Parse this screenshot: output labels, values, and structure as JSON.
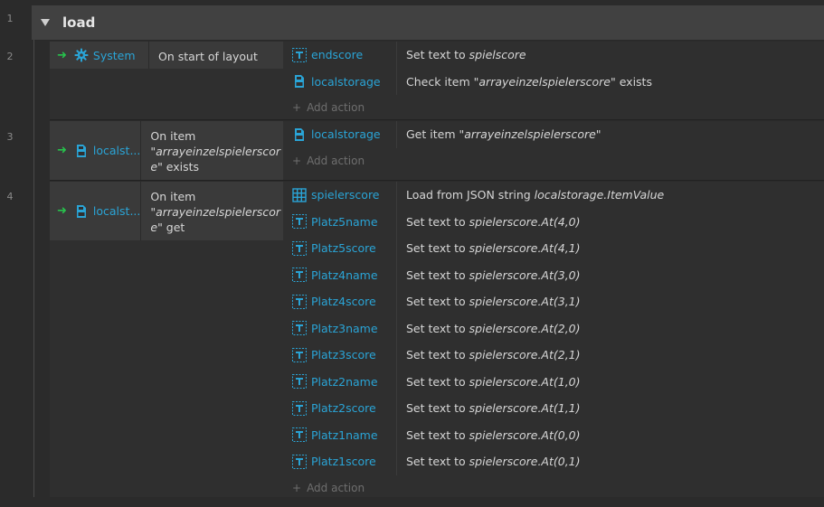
{
  "line_numbers": [
    "1",
    "2",
    "3",
    "4"
  ],
  "group": {
    "title": "load"
  },
  "add_action_label": "Add action",
  "events": [
    {
      "condition": {
        "object": "System",
        "icon": "gear-icon",
        "parts": [
          {
            "t": "On start of layout",
            "i": false
          }
        ]
      },
      "actions": [
        {
          "object": "endscore",
          "icon": "text-icon",
          "parts": [
            {
              "t": "Set text to ",
              "i": false
            },
            {
              "t": "spielscore",
              "i": true
            }
          ]
        },
        {
          "object": "localstorage",
          "icon": "local-storage-icon",
          "parts": [
            {
              "t": "Check item ",
              "i": false
            },
            {
              "t": "\"arrayeinzelspielerscore\"",
              "i": true
            },
            {
              "t": " exists",
              "i": false
            }
          ]
        }
      ]
    },
    {
      "condition": {
        "object": "localst...",
        "icon": "local-storage-icon",
        "parts": [
          {
            "t": "On item ",
            "i": false
          },
          {
            "t": "\"arrayeinzelspielerscor",
            "i": true
          },
          {
            "t": "e\"",
            "i": true
          },
          {
            "t": " exists",
            "i": false
          }
        ]
      },
      "actions": [
        {
          "object": "localstorage",
          "icon": "local-storage-icon",
          "parts": [
            {
              "t": "Get item ",
              "i": false
            },
            {
              "t": "\"arrayeinzelspielerscore\"",
              "i": true
            }
          ]
        }
      ]
    },
    {
      "condition": {
        "object": "localst...",
        "icon": "local-storage-icon",
        "parts": [
          {
            "t": "On item ",
            "i": false
          },
          {
            "t": "\"arrayeinzelspielerscor",
            "i": true
          },
          {
            "t": "e\"",
            "i": true
          },
          {
            "t": " get",
            "i": false
          }
        ]
      },
      "actions": [
        {
          "object": "spielerscore",
          "icon": "array-grid-icon",
          "parts": [
            {
              "t": "Load from JSON string ",
              "i": false
            },
            {
              "t": "localstorage.ItemValue",
              "i": true
            }
          ]
        },
        {
          "object": "Platz5name",
          "icon": "text-icon",
          "parts": [
            {
              "t": "Set text to ",
              "i": false
            },
            {
              "t": "spielerscore.At",
              "i": true
            },
            {
              "t": "(4,0)",
              "i": true
            }
          ]
        },
        {
          "object": "Platz5score",
          "icon": "text-icon",
          "parts": [
            {
              "t": "Set text to ",
              "i": false
            },
            {
              "t": "spielerscore.At",
              "i": true
            },
            {
              "t": "(4,1)",
              "i": true
            }
          ]
        },
        {
          "object": "Platz4name",
          "icon": "text-icon",
          "parts": [
            {
              "t": "Set text to ",
              "i": false
            },
            {
              "t": "spielerscore.At",
              "i": true
            },
            {
              "t": "(3,0)",
              "i": true
            }
          ]
        },
        {
          "object": "Platz4score",
          "icon": "text-icon",
          "parts": [
            {
              "t": "Set text to ",
              "i": false
            },
            {
              "t": "spielerscore.At",
              "i": true
            },
            {
              "t": "(3,1)",
              "i": true
            }
          ]
        },
        {
          "object": "Platz3name",
          "icon": "text-icon",
          "parts": [
            {
              "t": "Set text to ",
              "i": false
            },
            {
              "t": "spielerscore.At",
              "i": true
            },
            {
              "t": "(2,0)",
              "i": true
            }
          ]
        },
        {
          "object": "Platz3score",
          "icon": "text-icon",
          "parts": [
            {
              "t": "Set text to ",
              "i": false
            },
            {
              "t": "spielerscore.At",
              "i": true
            },
            {
              "t": "(2,1)",
              "i": true
            }
          ]
        },
        {
          "object": "Platz2name",
          "icon": "text-icon",
          "parts": [
            {
              "t": "Set text to ",
              "i": false
            },
            {
              "t": "spielerscore.At",
              "i": true
            },
            {
              "t": "(1,0)",
              "i": true
            }
          ]
        },
        {
          "object": "Platz2score",
          "icon": "text-icon",
          "parts": [
            {
              "t": "Set text to ",
              "i": false
            },
            {
              "t": "spielerscore.At",
              "i": true
            },
            {
              "t": "(1,1)",
              "i": true
            }
          ]
        },
        {
          "object": "Platz1name",
          "icon": "text-icon",
          "parts": [
            {
              "t": "Set text to ",
              "i": false
            },
            {
              "t": "spielerscore.At",
              "i": true
            },
            {
              "t": "(0,0)",
              "i": true
            }
          ]
        },
        {
          "object": "Platz1score",
          "icon": "text-icon",
          "parts": [
            {
              "t": "Set text to ",
              "i": false
            },
            {
              "t": "spielerscore.At",
              "i": true
            },
            {
              "t": "(0,1)",
              "i": true
            }
          ]
        }
      ]
    }
  ]
}
